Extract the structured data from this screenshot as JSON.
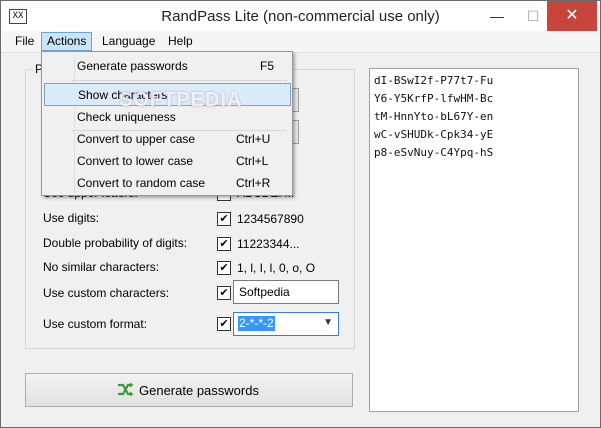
{
  "window": {
    "title": "RandPass Lite (non-commercial use only)",
    "icon_text": "XX",
    "min_glyph": "—",
    "max_glyph": "☐",
    "close_glyph": "✕"
  },
  "menubar": {
    "items": [
      {
        "label": "File"
      },
      {
        "label": "Actions"
      },
      {
        "label": "Language"
      },
      {
        "label": "Help"
      }
    ]
  },
  "group_label_partial": "P",
  "options": [
    {
      "label": "Use upper letters:",
      "value": "ABCDEF...",
      "checked": true
    },
    {
      "label": "Use digits:",
      "value": "1234567890",
      "checked": true
    },
    {
      "label": "Double probability of digits:",
      "value": "11223344...",
      "checked": true
    },
    {
      "label": "No similar characters:",
      "value": "1, l, I, l, 0, o, O",
      "checked": true
    },
    {
      "label": "Use custom characters:",
      "value": "Softpedia",
      "checked": true
    },
    {
      "label": "Use custom format:",
      "value": "2-*-*-2",
      "checked": true
    }
  ],
  "check_glyph": "✔",
  "combo_arrow": "▼",
  "generate_button": {
    "label": "Generate passwords"
  },
  "passwords": [
    "dI-BSwI2f-P77t7-Fu",
    "Y6-Y5KrfP-lfwHM-Bc",
    "tM-HnnYto-bL67Y-en",
    "wC-vSHUDk-Cpk34-yE",
    "p8-eSvNuy-C4Ypq-hS"
  ],
  "actions_menu": [
    {
      "label": "Generate passwords",
      "shortcut": "F5"
    },
    {
      "label": "Show characters",
      "shortcut": ""
    },
    {
      "label": "Check uniqueness",
      "shortcut": ""
    },
    {
      "label": "Convert to upper case",
      "shortcut": "Ctrl+U"
    },
    {
      "label": "Convert to lower case",
      "shortcut": "Ctrl+L"
    },
    {
      "label": "Convert to random case",
      "shortcut": "Ctrl+R"
    }
  ],
  "watermark": "SOFTPEDIA",
  "colors": {
    "close_red": "#c7453b",
    "highlight": "#dcebfc",
    "selection": "#3399ff",
    "accent_green": "#3a9a3a"
  }
}
